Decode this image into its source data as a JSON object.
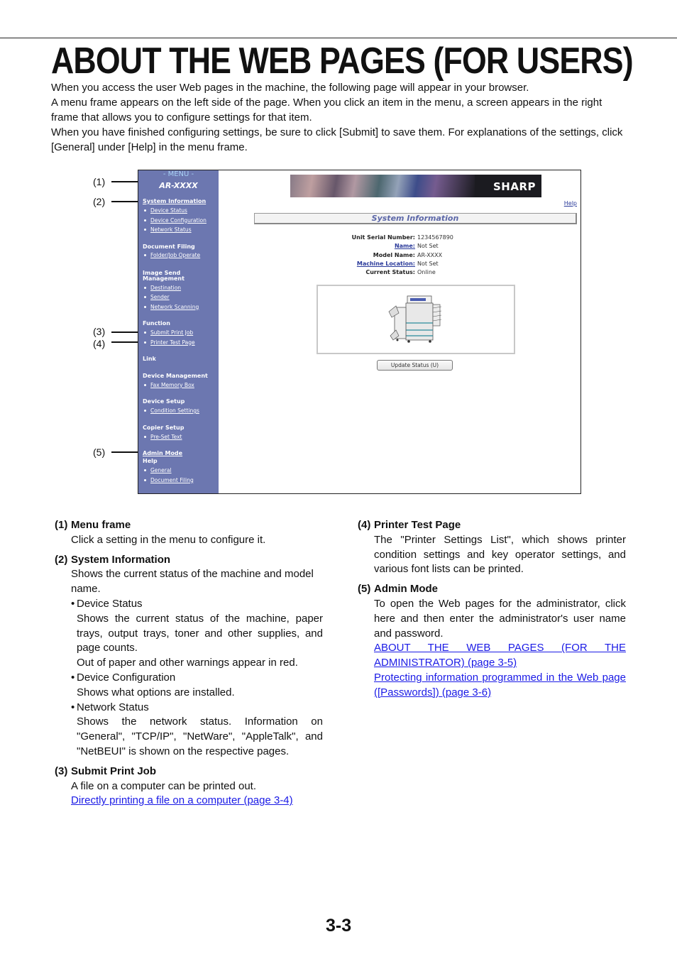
{
  "page_title": "ABOUT THE WEB PAGES (FOR USERS)",
  "intro": [
    "When you access the user Web pages in the machine, the following page will appear in your browser.",
    "A menu frame appears on the left side of the page. When you click an item in the menu, a screen appears in the right frame that allows you to configure settings for that item.",
    "When you have finished configuring settings, be sure to click [Submit] to save them. For explanations of the settings, click [General] under [Help] in the menu frame."
  ],
  "screenshot": {
    "menu": {
      "header": "- MENU -",
      "model": "AR-XXXX",
      "sections": [
        {
          "title": "System Information",
          "link": true,
          "items": [
            "Device Status",
            "Device Configuration",
            "Network Status"
          ]
        },
        {
          "title": "Document Filing",
          "items": [
            "Folder/Job Operate"
          ]
        },
        {
          "title": "Image Send",
          "title2": "Management",
          "items": [
            "Destination",
            "Sender",
            "Network Scanning"
          ]
        },
        {
          "title": "Function",
          "items": [
            "Submit Print Job",
            "Printer Test Page"
          ]
        },
        {
          "title": "Link",
          "items": []
        },
        {
          "title": "Device Management",
          "items": [
            "Fax Memory Box"
          ]
        },
        {
          "title": "Device Setup",
          "items": [
            "Condition Settings"
          ]
        },
        {
          "title": "Copier Setup",
          "items": [
            "Pre-Set Text"
          ]
        },
        {
          "title": "Admin Mode",
          "link": true,
          "items": []
        },
        {
          "title": "Help",
          "items": [
            "General",
            "Document Filing"
          ]
        }
      ]
    },
    "banner_logo": "SHARP",
    "help_link": "Help",
    "section_title": "System Information",
    "info_rows": [
      {
        "label": "Unit Serial Number:",
        "value": "1234567890",
        "link": false
      },
      {
        "label": "Name:",
        "value": "Not Set",
        "link": true
      },
      {
        "label": "Model Name:",
        "value": "AR-XXXX",
        "link": false
      },
      {
        "label": "Machine Location:",
        "value": "Not Set",
        "link": true
      },
      {
        "label": "Current Status:",
        "value": "Online",
        "link": false
      }
    ],
    "update_button": "Update Status (U)",
    "callouts": [
      "(1)",
      "(2)",
      "(3)",
      "(4)",
      "(5)"
    ]
  },
  "descriptions": {
    "e1": {
      "num": "(1)",
      "title": "Menu frame",
      "text": "Click a setting in the menu to configure it."
    },
    "e2": {
      "num": "(2)",
      "title": "System Information",
      "text": "Shows the current status of the machine and model name.",
      "subs": [
        {
          "title": "Device Status",
          "lines": [
            "Shows the current status of the machine, paper trays, output trays, toner and other supplies, and page counts.",
            "Out of paper and other warnings appear in red."
          ]
        },
        {
          "title": "Device Configuration",
          "lines": [
            "Shows what options are installed."
          ]
        },
        {
          "title": "Network Status",
          "lines": [
            "Shows the network status. Information on \"General\", \"TCP/IP\", \"NetWare\", \"AppleTalk\", and \"NetBEUI\" is shown on the respective pages."
          ]
        }
      ]
    },
    "e3": {
      "num": "(3)",
      "title": "Submit Print Job",
      "text": "A file on a computer can be printed out.",
      "link": "Directly printing a file on a computer (page 3-4)"
    },
    "e4": {
      "num": "(4)",
      "title": "Printer Test Page",
      "text": "The \"Printer Settings List\", which shows printer condition settings and key operator settings, and various font lists can be printed."
    },
    "e5": {
      "num": "(5)",
      "title": "Admin Mode",
      "text": "To open the Web pages for the administrator, click here and then enter the administrator's user name and password.",
      "links": [
        "ABOUT THE WEB PAGES (FOR THE ADMINISTRATOR) (page 3-5)",
        "Protecting information programmed in the Web page ([Passwords]) (page 3-6)"
      ]
    }
  },
  "page_number": "3-3"
}
